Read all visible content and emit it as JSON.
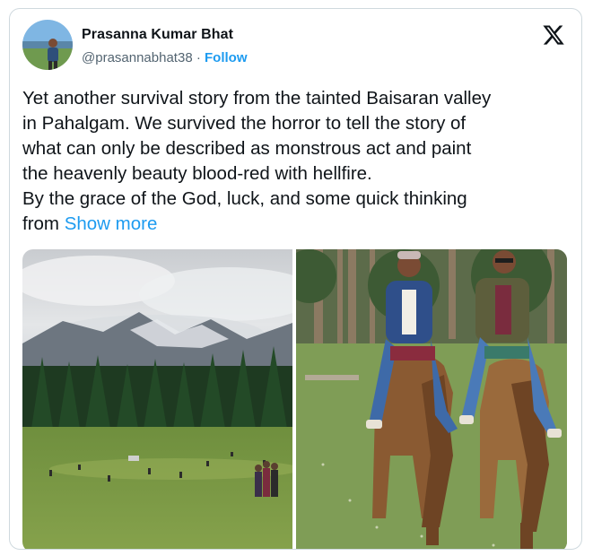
{
  "author": {
    "display_name": "Prasanna Kumar Bhat",
    "handle": "@prasannabhat38",
    "separator": "·",
    "follow_label": "Follow"
  },
  "platform": {
    "logo_icon": "x-logo-icon"
  },
  "tweet": {
    "line1": "Yet another survival story from the tainted Baisaran valley",
    "line2": "in Pahalgam.  We survived the horror to tell the story of",
    "line3": "what can only be described  as monstrous act and paint",
    "line4": "the heavenly beauty blood-red with hellfire.",
    "line5": "By  the grace of the God, luck, and some quick thinking",
    "line6_prefix": "from ",
    "show_more_label": "Show more"
  },
  "media": {
    "photos": [
      "meadow-landscape-photo",
      "horse-riders-photo"
    ]
  },
  "colors": {
    "link": "#1d9bf0",
    "text": "#0f1419",
    "secondary": "#536471",
    "border": "#cfd9de"
  }
}
